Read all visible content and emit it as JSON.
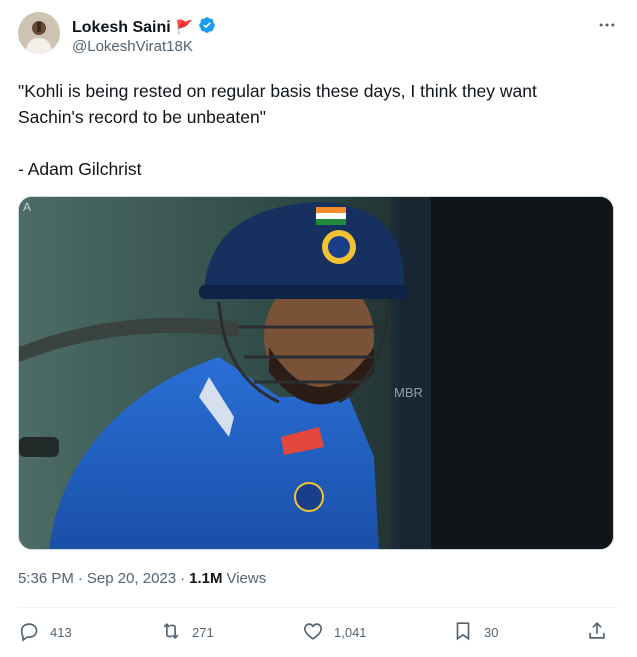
{
  "author": {
    "name": "Lokesh Saini",
    "handle": "@LokeshVirat18K",
    "flag_emoji": "🚩",
    "verified_icon": "verified-badge-icon",
    "verified_color": "#1d9bf0"
  },
  "tweet": {
    "line1": "\"Kohli is being rested on regular basis these days, I think they want",
    "line2": "Sachin's record to be unbeaten\"",
    "line3": "- Adam Gilchrist"
  },
  "meta": {
    "time": "5:36 PM",
    "separator": "·",
    "date": "Sep 20, 2023",
    "separator2": "·",
    "views_count": "1.1M",
    "views_label": "Views"
  },
  "actions": {
    "replies": "413",
    "retweets": "271",
    "likes": "1,041",
    "bookmarks": "30"
  },
  "icons": {
    "more": "more-horizontal-icon",
    "reply": "reply-icon",
    "retweet": "retweet-icon",
    "like": "heart-icon",
    "bookmark": "bookmark-icon",
    "share": "share-icon"
  },
  "colors": {
    "text": "#0f1419",
    "secondary": "#536471",
    "accent": "#1d9bf0"
  }
}
